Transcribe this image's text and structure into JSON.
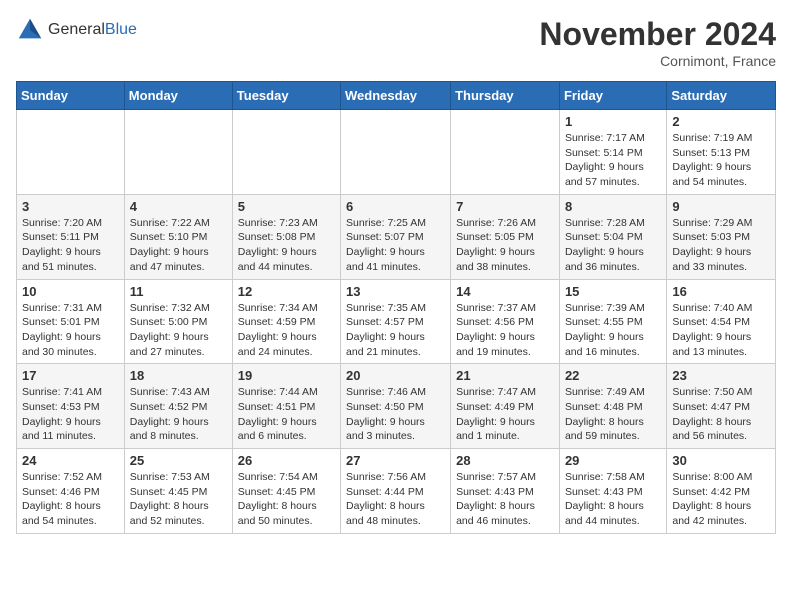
{
  "logo": {
    "general": "General",
    "blue": "Blue"
  },
  "title": "November 2024",
  "location": "Cornimont, France",
  "days_of_week": [
    "Sunday",
    "Monday",
    "Tuesday",
    "Wednesday",
    "Thursday",
    "Friday",
    "Saturday"
  ],
  "weeks": [
    [
      {
        "day": "",
        "info": ""
      },
      {
        "day": "",
        "info": ""
      },
      {
        "day": "",
        "info": ""
      },
      {
        "day": "",
        "info": ""
      },
      {
        "day": "",
        "info": ""
      },
      {
        "day": "1",
        "info": "Sunrise: 7:17 AM\nSunset: 5:14 PM\nDaylight: 9 hours\nand 57 minutes."
      },
      {
        "day": "2",
        "info": "Sunrise: 7:19 AM\nSunset: 5:13 PM\nDaylight: 9 hours\nand 54 minutes."
      }
    ],
    [
      {
        "day": "3",
        "info": "Sunrise: 7:20 AM\nSunset: 5:11 PM\nDaylight: 9 hours\nand 51 minutes."
      },
      {
        "day": "4",
        "info": "Sunrise: 7:22 AM\nSunset: 5:10 PM\nDaylight: 9 hours\nand 47 minutes."
      },
      {
        "day": "5",
        "info": "Sunrise: 7:23 AM\nSunset: 5:08 PM\nDaylight: 9 hours\nand 44 minutes."
      },
      {
        "day": "6",
        "info": "Sunrise: 7:25 AM\nSunset: 5:07 PM\nDaylight: 9 hours\nand 41 minutes."
      },
      {
        "day": "7",
        "info": "Sunrise: 7:26 AM\nSunset: 5:05 PM\nDaylight: 9 hours\nand 38 minutes."
      },
      {
        "day": "8",
        "info": "Sunrise: 7:28 AM\nSunset: 5:04 PM\nDaylight: 9 hours\nand 36 minutes."
      },
      {
        "day": "9",
        "info": "Sunrise: 7:29 AM\nSunset: 5:03 PM\nDaylight: 9 hours\nand 33 minutes."
      }
    ],
    [
      {
        "day": "10",
        "info": "Sunrise: 7:31 AM\nSunset: 5:01 PM\nDaylight: 9 hours\nand 30 minutes."
      },
      {
        "day": "11",
        "info": "Sunrise: 7:32 AM\nSunset: 5:00 PM\nDaylight: 9 hours\nand 27 minutes."
      },
      {
        "day": "12",
        "info": "Sunrise: 7:34 AM\nSunset: 4:59 PM\nDaylight: 9 hours\nand 24 minutes."
      },
      {
        "day": "13",
        "info": "Sunrise: 7:35 AM\nSunset: 4:57 PM\nDaylight: 9 hours\nand 21 minutes."
      },
      {
        "day": "14",
        "info": "Sunrise: 7:37 AM\nSunset: 4:56 PM\nDaylight: 9 hours\nand 19 minutes."
      },
      {
        "day": "15",
        "info": "Sunrise: 7:39 AM\nSunset: 4:55 PM\nDaylight: 9 hours\nand 16 minutes."
      },
      {
        "day": "16",
        "info": "Sunrise: 7:40 AM\nSunset: 4:54 PM\nDaylight: 9 hours\nand 13 minutes."
      }
    ],
    [
      {
        "day": "17",
        "info": "Sunrise: 7:41 AM\nSunset: 4:53 PM\nDaylight: 9 hours\nand 11 minutes."
      },
      {
        "day": "18",
        "info": "Sunrise: 7:43 AM\nSunset: 4:52 PM\nDaylight: 9 hours\nand 8 minutes."
      },
      {
        "day": "19",
        "info": "Sunrise: 7:44 AM\nSunset: 4:51 PM\nDaylight: 9 hours\nand 6 minutes."
      },
      {
        "day": "20",
        "info": "Sunrise: 7:46 AM\nSunset: 4:50 PM\nDaylight: 9 hours\nand 3 minutes."
      },
      {
        "day": "21",
        "info": "Sunrise: 7:47 AM\nSunset: 4:49 PM\nDaylight: 9 hours\nand 1 minute."
      },
      {
        "day": "22",
        "info": "Sunrise: 7:49 AM\nSunset: 4:48 PM\nDaylight: 8 hours\nand 59 minutes."
      },
      {
        "day": "23",
        "info": "Sunrise: 7:50 AM\nSunset: 4:47 PM\nDaylight: 8 hours\nand 56 minutes."
      }
    ],
    [
      {
        "day": "24",
        "info": "Sunrise: 7:52 AM\nSunset: 4:46 PM\nDaylight: 8 hours\nand 54 minutes."
      },
      {
        "day": "25",
        "info": "Sunrise: 7:53 AM\nSunset: 4:45 PM\nDaylight: 8 hours\nand 52 minutes."
      },
      {
        "day": "26",
        "info": "Sunrise: 7:54 AM\nSunset: 4:45 PM\nDaylight: 8 hours\nand 50 minutes."
      },
      {
        "day": "27",
        "info": "Sunrise: 7:56 AM\nSunset: 4:44 PM\nDaylight: 8 hours\nand 48 minutes."
      },
      {
        "day": "28",
        "info": "Sunrise: 7:57 AM\nSunset: 4:43 PM\nDaylight: 8 hours\nand 46 minutes."
      },
      {
        "day": "29",
        "info": "Sunrise: 7:58 AM\nSunset: 4:43 PM\nDaylight: 8 hours\nand 44 minutes."
      },
      {
        "day": "30",
        "info": "Sunrise: 8:00 AM\nSunset: 4:42 PM\nDaylight: 8 hours\nand 42 minutes."
      }
    ]
  ]
}
